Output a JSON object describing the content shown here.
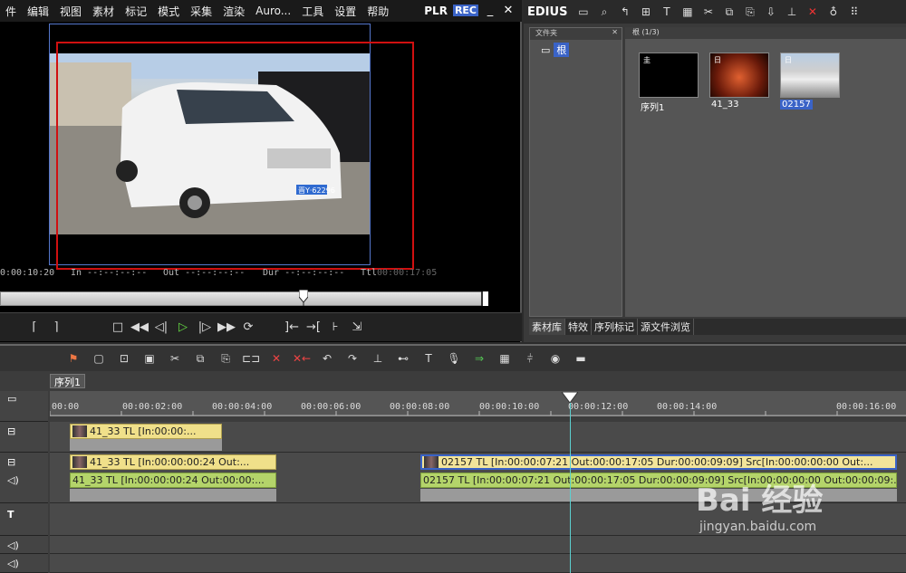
{
  "menu": [
    "件",
    "编辑",
    "视图",
    "素材",
    "标记",
    "模式",
    "采集",
    "渲染",
    "Auro...",
    "工具",
    "设置",
    "帮助"
  ],
  "player": {
    "plr": "PLR",
    "rec": "REC",
    "minimize": "_",
    "close": "✕",
    "plate": "晋Y·62296"
  },
  "timecodes": {
    "current": "0:00:10:20",
    "in": "In --:--:--:--",
    "out": "Out --:--:--:--",
    "dur": "Dur --:--:--:--",
    "ttl_label": "Ttl",
    "ttl": "00:00:17:05"
  },
  "bin": {
    "app": "EDIUS",
    "folder_header": "文件夹",
    "folder_close": "✕",
    "root_label": "根",
    "clip_header": "根 (1/3)",
    "clips": [
      {
        "label": "序列1",
        "badge": "圭"
      },
      {
        "label": "41_33",
        "badge": "日"
      },
      {
        "label": "02157",
        "badge": "日"
      }
    ],
    "tabs": [
      "素材库",
      "特效",
      "序列标记",
      "源文件浏览"
    ]
  },
  "timeline": {
    "sequence_tab": "序列1",
    "ruler": [
      "00:00",
      "00:00:02:00",
      "00:00:04:00",
      "00:00:06:00",
      "00:00:08:00",
      "00:00:10:00",
      "00:00:12:00",
      "00:00:14:00",
      "00:00:16:00"
    ],
    "clip_v1": "41_33  TL [In:00:00:...",
    "clip_v2": "41_33  TL [In:00:00:00:24 Out:...",
    "clip_a2": "41_33  TL [In:00:00:00:24 Out:00:00:...",
    "clip_v2b": "02157  TL [In:00:00:07:21 Out:00:00:17:05 Dur:00:00:09:09]  Src[In:00:00:00:00 Out:...",
    "clip_a2b": "02157  TL [In:00:00:07:21 Out:00:00:17:05 Dur:00:00:09:09]  Src[In:00:00:00:00 Out:00:00:09:..."
  },
  "watermark": {
    "logo": "Bai 经验",
    "url": "jingyan.baidu.com"
  },
  "colors": {
    "accent": "#3a63c7",
    "safe_rect": "#d01010",
    "cursor": "#5cd0d0",
    "clip_yellow": "#f0e08a",
    "clip_green": "#b4d46a"
  }
}
